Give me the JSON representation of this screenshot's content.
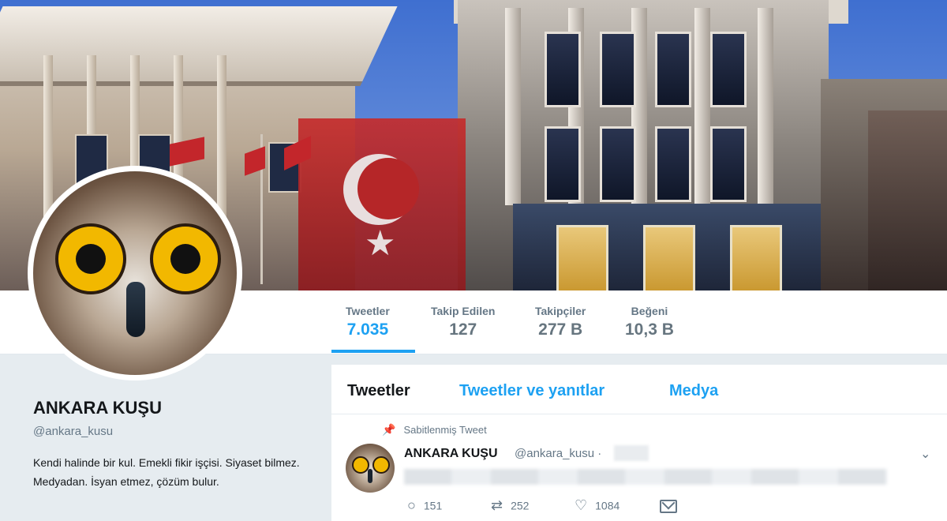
{
  "profile": {
    "name": "ANKARA KUŞU",
    "handle": "@ankara_kusu",
    "bio": "Kendi halinde bir kul. Emekli fikir işçisi. Siyaset bilmez. Medyadan. İsyan etmez, çözüm bulur."
  },
  "stats": [
    {
      "label": "Tweetler",
      "value": "7.035",
      "active": true
    },
    {
      "label": "Takip Edilen",
      "value": "127",
      "active": false
    },
    {
      "label": "Takipçiler",
      "value": "277 B",
      "active": false
    },
    {
      "label": "Beğeni",
      "value": "10,3 B",
      "active": false
    }
  ],
  "tabs": [
    {
      "label": "Tweetler",
      "active": true
    },
    {
      "label": "Tweetler ve yanıtlar",
      "active": false
    },
    {
      "label": "Medya",
      "active": false
    }
  ],
  "pinned_tweet": {
    "pinned_label": "Sabitlenmiş Tweet",
    "author_name": "ANKARA KUŞU",
    "author_handle": "@ankara_kusu ·",
    "actions": {
      "reply_count": "151",
      "retweet_count": "252",
      "like_count": "1084"
    }
  },
  "icons": {
    "pin": "pin-icon",
    "reply": "reply-icon",
    "retweet": "retweet-icon",
    "like": "heart-icon",
    "message": "envelope-icon",
    "caret": "chevron-down-icon"
  },
  "colors": {
    "accent": "#1da1f2",
    "text": "#14171a",
    "muted": "#657786",
    "background": "#e6ecf0"
  }
}
